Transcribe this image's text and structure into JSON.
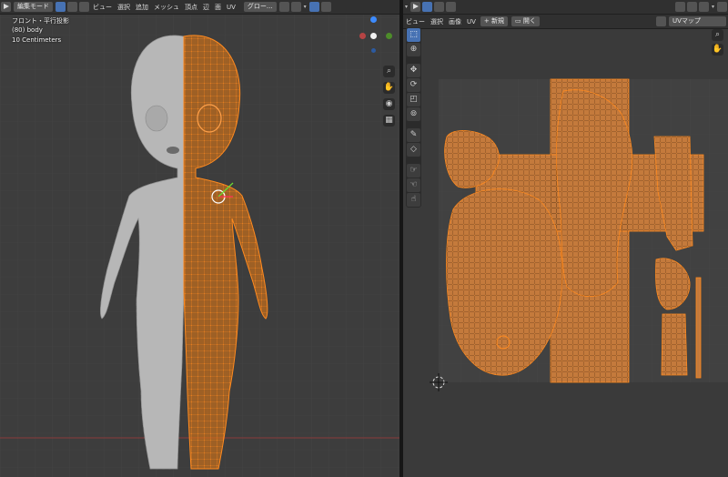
{
  "viewport": {
    "mode": "編集モード",
    "menus": [
      "ビュー",
      "選択",
      "追加",
      "メッシュ",
      "頂点",
      "辺",
      "面",
      "UV"
    ],
    "transform_orientation": "グロー...",
    "view_name": "フロント・平行投影",
    "object_info": "(80) body",
    "grid_scale": "10 Centimeters"
  },
  "uv_editor": {
    "menus": [
      "ビュー",
      "選択",
      "画像",
      "UV"
    ],
    "new_button": "新規",
    "open_button": "開く",
    "uv_map": "UVマップ"
  },
  "colors": {
    "accent": "#4772b3",
    "mesh_select": "#f08c27",
    "uv_fill": "#c47a3c"
  },
  "icons": [
    "editor-type-icon",
    "vertex-select-icon",
    "edge-select-icon",
    "face-select-icon",
    "snap-icon",
    "proportional-icon",
    "overlay-icon",
    "xray-icon",
    "zoom-icon",
    "hand-icon",
    "camera-icon",
    "grid-icon",
    "cursor-icon",
    "move-icon",
    "rotate-icon",
    "scale-icon",
    "transform-icon",
    "annotate-icon",
    "rip-icon",
    "grab-icon",
    "relax-icon",
    "pin-icon"
  ]
}
